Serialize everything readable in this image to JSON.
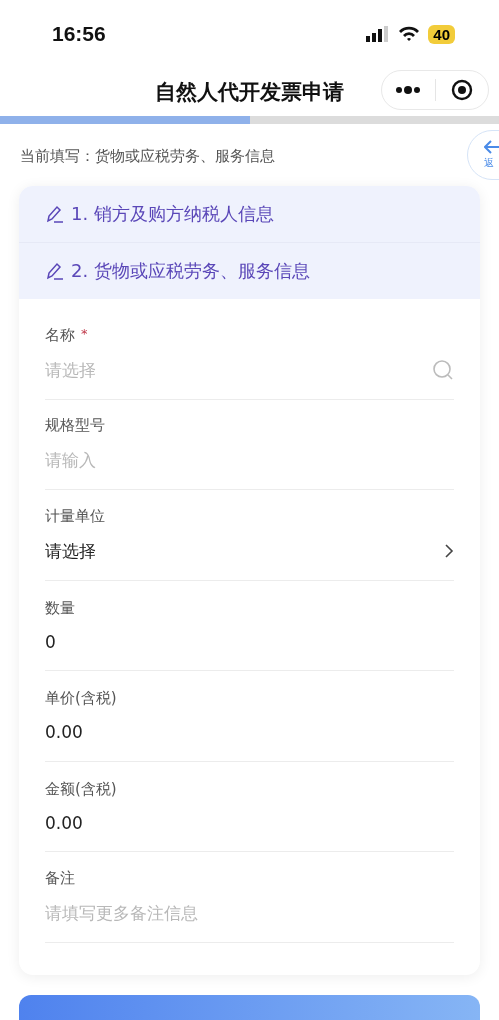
{
  "status_bar": {
    "time": "16:56",
    "battery": "40"
  },
  "nav": {
    "title": "自然人代开发票申请"
  },
  "progress": {
    "level": 0.5
  },
  "current": "当前填写：货物或应税劳务、服务信息",
  "side_button": {
    "label": "返"
  },
  "required_mark": "*",
  "steps": [
    {
      "label": "1. 销方及购方纳税人信息"
    },
    {
      "label": "2. 货物或应税劳务、服务信息"
    }
  ],
  "fields": [
    {
      "label": "名称",
      "required": true,
      "kind": "search",
      "placeholder": "请选择"
    },
    {
      "label": "规格型号",
      "required": false,
      "kind": "input",
      "placeholder": "请输入"
    },
    {
      "label": "计量单位",
      "required": false,
      "kind": "select",
      "value": "请选择"
    },
    {
      "label": "数量",
      "required": false,
      "kind": "input",
      "value": "0"
    },
    {
      "label": "单价(含税)",
      "required": false,
      "kind": "input",
      "value": "0.00"
    },
    {
      "label": "金额(含税)",
      "required": false,
      "kind": "input",
      "value": "0.00"
    },
    {
      "label": "备注",
      "required": false,
      "kind": "input",
      "placeholder": "请填写更多备注信息"
    }
  ]
}
